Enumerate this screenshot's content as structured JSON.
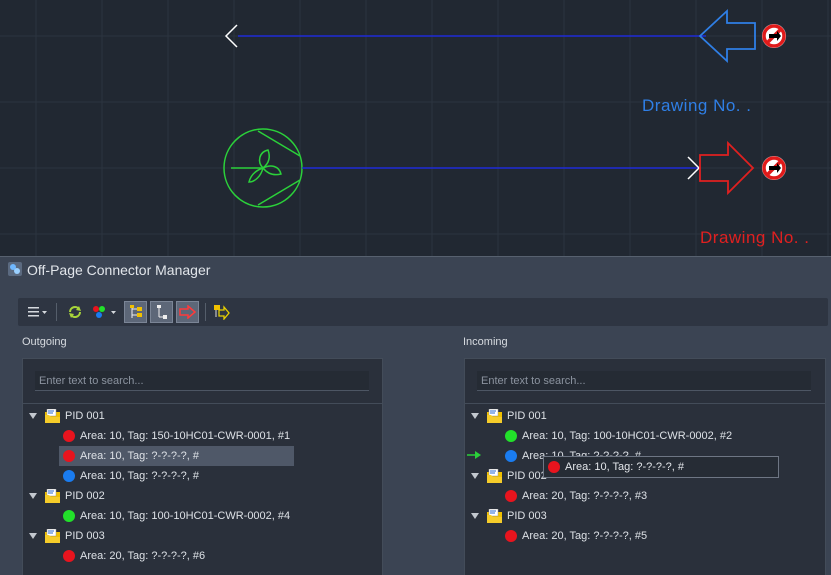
{
  "drawing": {
    "top_label": "Drawing No. .",
    "bottom_label": "Drawing No. .",
    "colors": {
      "background": "#212832",
      "grid": "#2c3440",
      "pipe": "#1f2ad8",
      "outgoing_connector": "#2f7fe6",
      "incoming_connector": "#e02020",
      "pump": "#2bd13a"
    }
  },
  "window": {
    "title": "Off-Page Connector Manager"
  },
  "toolbar": {
    "icons": [
      "menu-icon",
      "refresh-icon",
      "color-dots-icon",
      "tree-expand-icon",
      "tree-collapse-icon",
      "connector-arrow-icon",
      "go-to-icon"
    ]
  },
  "outgoing": {
    "label": "Outgoing",
    "search_placeholder": "Enter text to search...",
    "groups": [
      {
        "name": "PID 001",
        "items": [
          {
            "text": "Area: 10, Tag: 150-10HC01-CWR-0001, #1",
            "color": "#e8141e"
          },
          {
            "text": "Area: 10, Tag: ?-?-?-?, #",
            "color": "#e8141e",
            "selected": true
          },
          {
            "text": "Area: 10, Tag: ?-?-?-?, #",
            "color": "#1a7cf0"
          }
        ]
      },
      {
        "name": "PID 002",
        "items": [
          {
            "text": "Area: 10, Tag: 100-10HC01-CWR-0002, #4",
            "color": "#22e02a"
          }
        ]
      },
      {
        "name": "PID 003",
        "items": [
          {
            "text": "Area: 20, Tag: ?-?-?-?, #6",
            "color": "#e8141e"
          }
        ]
      }
    ]
  },
  "incoming": {
    "label": "Incoming",
    "search_placeholder": "Enter text to search...",
    "groups": [
      {
        "name": "PID 001",
        "items": [
          {
            "text": "Area: 10, Tag: 100-10HC01-CWR-0002, #2",
            "color": "#22e02a"
          },
          {
            "text": "Area: 10, Tag: ?-?-?-?, #",
            "color": "#1a7cf0"
          }
        ]
      },
      {
        "name": "PID 002",
        "items": [
          {
            "text": "Area: 20, Tag: ?-?-?-?, #3",
            "color": "#e8141e"
          }
        ]
      },
      {
        "name": "PID 003",
        "items": [
          {
            "text": "Area: 20, Tag: ?-?-?-?, #5",
            "color": "#e8141e"
          }
        ]
      }
    ],
    "drag_ghost": {
      "text": "Area: 10, Tag: ?-?-?-?, #",
      "color": "#e8141e"
    }
  }
}
